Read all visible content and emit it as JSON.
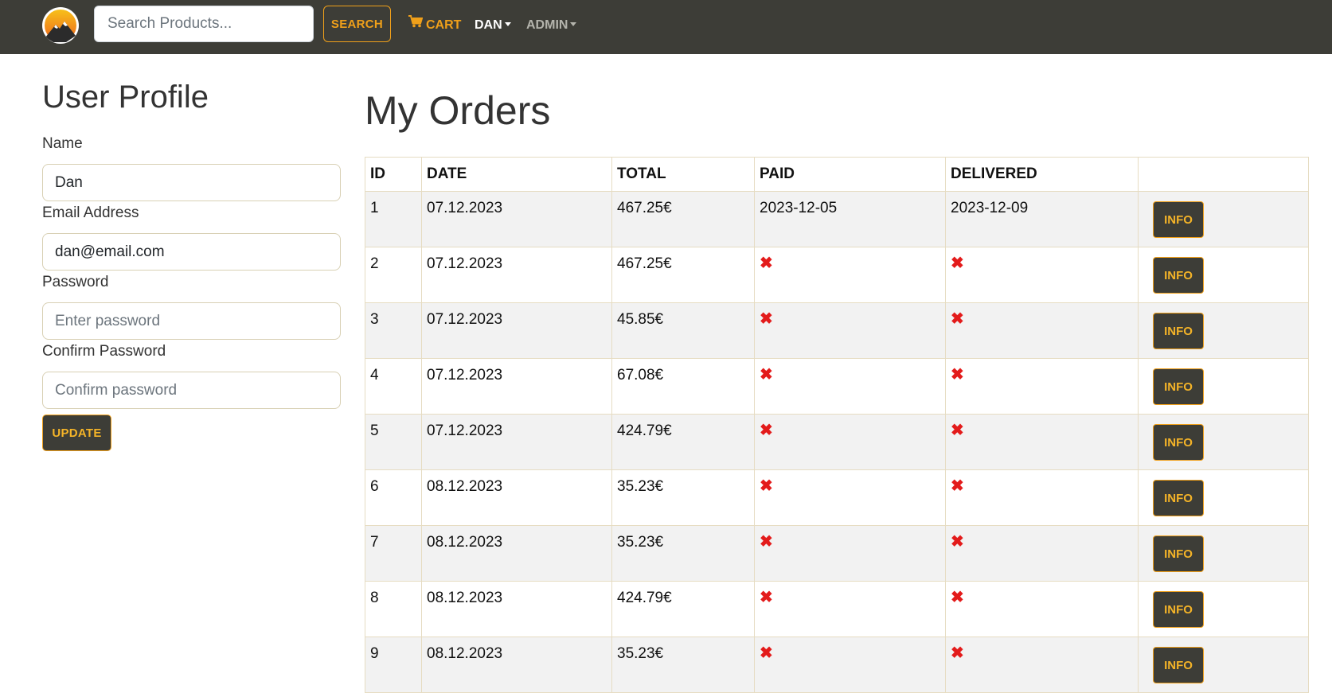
{
  "navbar": {
    "logo": "mountain-sun-logo",
    "search_placeholder": "Search Products...",
    "search_label": "SEARCH",
    "cart_label": "CART",
    "cart_icon": "shopping-cart-icon",
    "user_label": "DAN",
    "admin_label": "ADMIN",
    "colors": {
      "bar": "#3d3d37",
      "accent": "#f0a01a"
    }
  },
  "profile": {
    "title": "User Profile",
    "name_label": "Name",
    "name_value": "Dan",
    "email_label": "Email Address",
    "email_value": "dan@email.com",
    "password_label": "Password",
    "password_placeholder": "Enter password",
    "confirm_label": "Confirm Password",
    "confirm_placeholder": "Confirm password",
    "update_label": "UPDATE"
  },
  "orders": {
    "title": "My Orders",
    "columns": [
      "ID",
      "DATE",
      "TOTAL",
      "PAID",
      "DELIVERED",
      ""
    ],
    "info_label": "INFO",
    "not_done_icon": "times-icon",
    "rows": [
      {
        "id": "1",
        "date": "07.12.2023",
        "total": "467.25€",
        "paid": "2023-12-05",
        "delivered": "2023-12-09"
      },
      {
        "id": "2",
        "date": "07.12.2023",
        "total": "467.25€",
        "paid": null,
        "delivered": null
      },
      {
        "id": "3",
        "date": "07.12.2023",
        "total": "45.85€",
        "paid": null,
        "delivered": null
      },
      {
        "id": "4",
        "date": "07.12.2023",
        "total": "67.08€",
        "paid": null,
        "delivered": null
      },
      {
        "id": "5",
        "date": "07.12.2023",
        "total": "424.79€",
        "paid": null,
        "delivered": null
      },
      {
        "id": "6",
        "date": "08.12.2023",
        "total": "35.23€",
        "paid": null,
        "delivered": null
      },
      {
        "id": "7",
        "date": "08.12.2023",
        "total": "35.23€",
        "paid": null,
        "delivered": null
      },
      {
        "id": "8",
        "date": "08.12.2023",
        "total": "424.79€",
        "paid": null,
        "delivered": null
      },
      {
        "id": "9",
        "date": "08.12.2023",
        "total": "35.23€",
        "paid": null,
        "delivered": null
      }
    ]
  }
}
